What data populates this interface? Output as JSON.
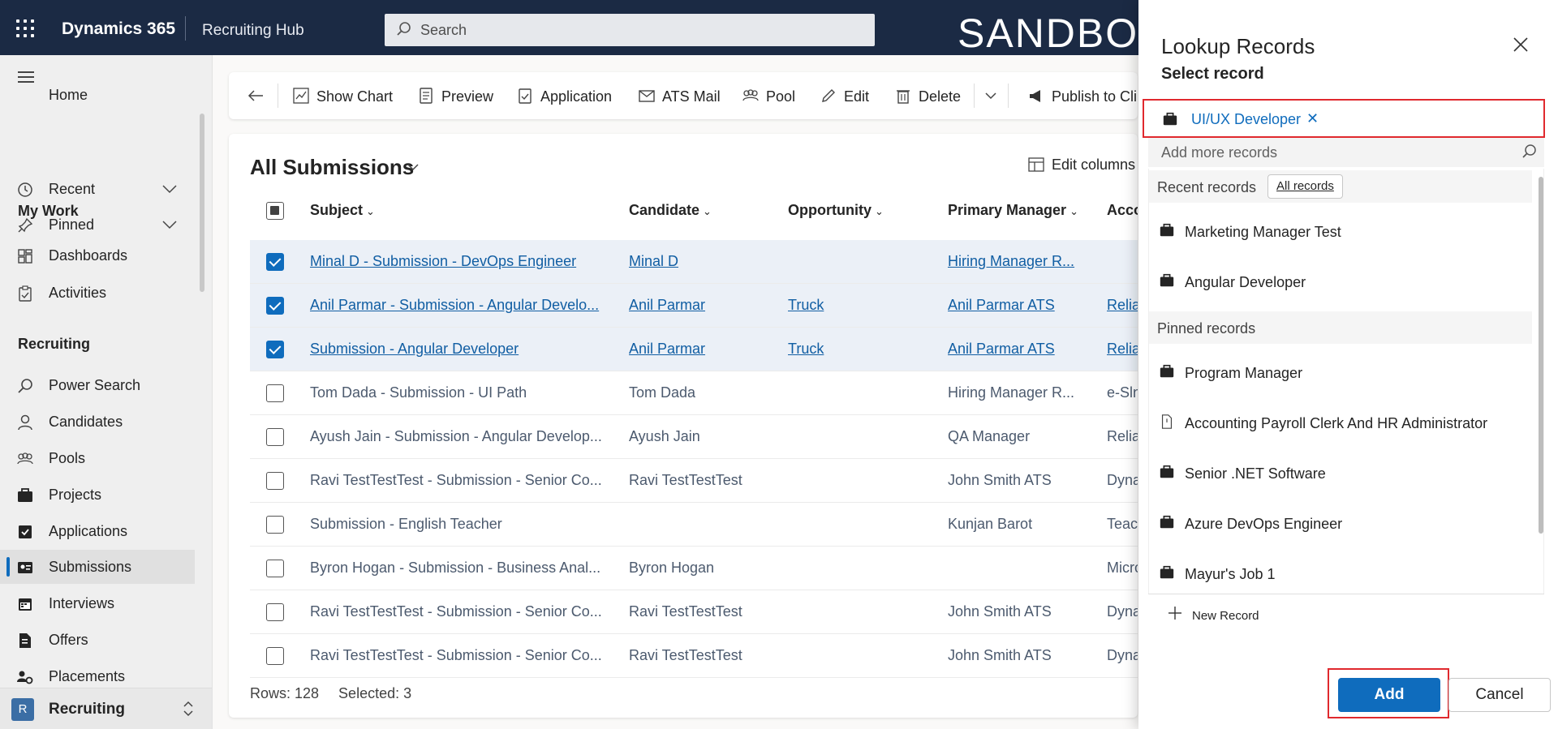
{
  "topbar": {
    "app_name": "Dynamics 365",
    "hub_name": "Recruiting Hub",
    "search_placeholder": "Search",
    "environment_label": "SANDBOX"
  },
  "leftnav": {
    "partial_top_item": "Home",
    "recent": "Recent",
    "pinned": "Pinned",
    "my_work_header": "My Work",
    "dashboards": "Dashboards",
    "activities": "Activities",
    "recruiting_header": "Recruiting",
    "items": [
      "Power Search",
      "Candidates",
      "Pools",
      "Projects",
      "Applications",
      "Submissions",
      "Interviews",
      "Offers",
      "Placements"
    ],
    "selected_item": "Submissions",
    "area_badge": "R",
    "area_name": "Recruiting"
  },
  "commandbar": {
    "show_chart": "Show Chart",
    "preview": "Preview",
    "application": "Application",
    "ats_mail": "ATS Mail",
    "pool": "Pool",
    "edit": "Edit",
    "delete": "Delete",
    "publish": "Publish to Cli"
  },
  "grid": {
    "view_title": "All Submissions",
    "edit_columns": "Edit columns",
    "columns": [
      "Subject",
      "Candidate",
      "Opportunity",
      "Primary Manager",
      "Acco"
    ],
    "rows": [
      {
        "selected": true,
        "subject": "Minal D - Submission - DevOps Engineer",
        "candidate": "Minal D",
        "opportunity": "",
        "manager": "Hiring Manager R...",
        "account": ""
      },
      {
        "selected": true,
        "subject": "Anil Parmar - Submission - Angular Develo...",
        "candidate": "Anil Parmar",
        "opportunity": "Truck",
        "manager": "Anil Parmar ATS",
        "account": "Relia"
      },
      {
        "selected": true,
        "subject": "Submission - Angular Developer",
        "candidate": "Anil Parmar",
        "opportunity": "Truck",
        "manager": "Anil Parmar ATS",
        "account": "Relia"
      },
      {
        "selected": false,
        "subject": "Tom Dada - Submission - UI Path",
        "candidate": "Tom Dada",
        "opportunity": "",
        "manager": "Hiring Manager R...",
        "account": "e-Sln"
      },
      {
        "selected": false,
        "subject": "Ayush Jain - Submission - Angular Develop...",
        "candidate": "Ayush Jain",
        "opportunity": "",
        "manager": "QA Manager",
        "account": "Relia"
      },
      {
        "selected": false,
        "subject": "Ravi TestTestTest - Submission - Senior Co...",
        "candidate": "Ravi TestTestTest",
        "opportunity": "",
        "manager": "John Smith ATS",
        "account": "Dyna"
      },
      {
        "selected": false,
        "subject": "Submission - English Teacher",
        "candidate": "",
        "opportunity": "",
        "manager": "Kunjan Barot",
        "account": "Teach"
      },
      {
        "selected": false,
        "subject": "Byron Hogan - Submission - Business Anal...",
        "candidate": "Byron Hogan",
        "opportunity": "",
        "manager": "",
        "account": "Micro"
      },
      {
        "selected": false,
        "subject": "Ravi TestTestTest - Submission - Senior Co...",
        "candidate": "Ravi TestTestTest",
        "opportunity": "",
        "manager": "John Smith ATS",
        "account": "Dyna"
      },
      {
        "selected": false,
        "subject": "Ravi TestTestTest - Submission - Senior Co...",
        "candidate": "Ravi TestTestTest",
        "opportunity": "",
        "manager": "John Smith ATS",
        "account": "Dyna"
      }
    ],
    "rows_label": "Rows: 128",
    "selected_label": "Selected: 3"
  },
  "dialog": {
    "title": "Lookup Records",
    "subtitle": "Select record",
    "selected_record": "UI/UX Developer",
    "add_more_placeholder": "Add more records",
    "recent_header": "Recent records",
    "all_records_button": "All records",
    "recent_records": [
      "Marketing Manager Test",
      "Angular Developer"
    ],
    "pinned_header": "Pinned records",
    "pinned_records": [
      {
        "label": "Program Manager",
        "icon": "briefcase-icon"
      },
      {
        "label": "Accounting Payroll Clerk And HR Administrator",
        "icon": "document-icon"
      },
      {
        "label": "Senior .NET Software",
        "icon": "briefcase-icon"
      },
      {
        "label": "Azure DevOps Engineer",
        "icon": "briefcase-icon"
      },
      {
        "label": "Mayur's Job 1",
        "icon": "briefcase-icon"
      }
    ],
    "new_record": "New Record",
    "add_button": "Add",
    "cancel_button": "Cancel"
  },
  "colors": {
    "topbar_bg": "#1b2a44",
    "accent": "#0f6cbd",
    "highlight": "#e0292e"
  }
}
